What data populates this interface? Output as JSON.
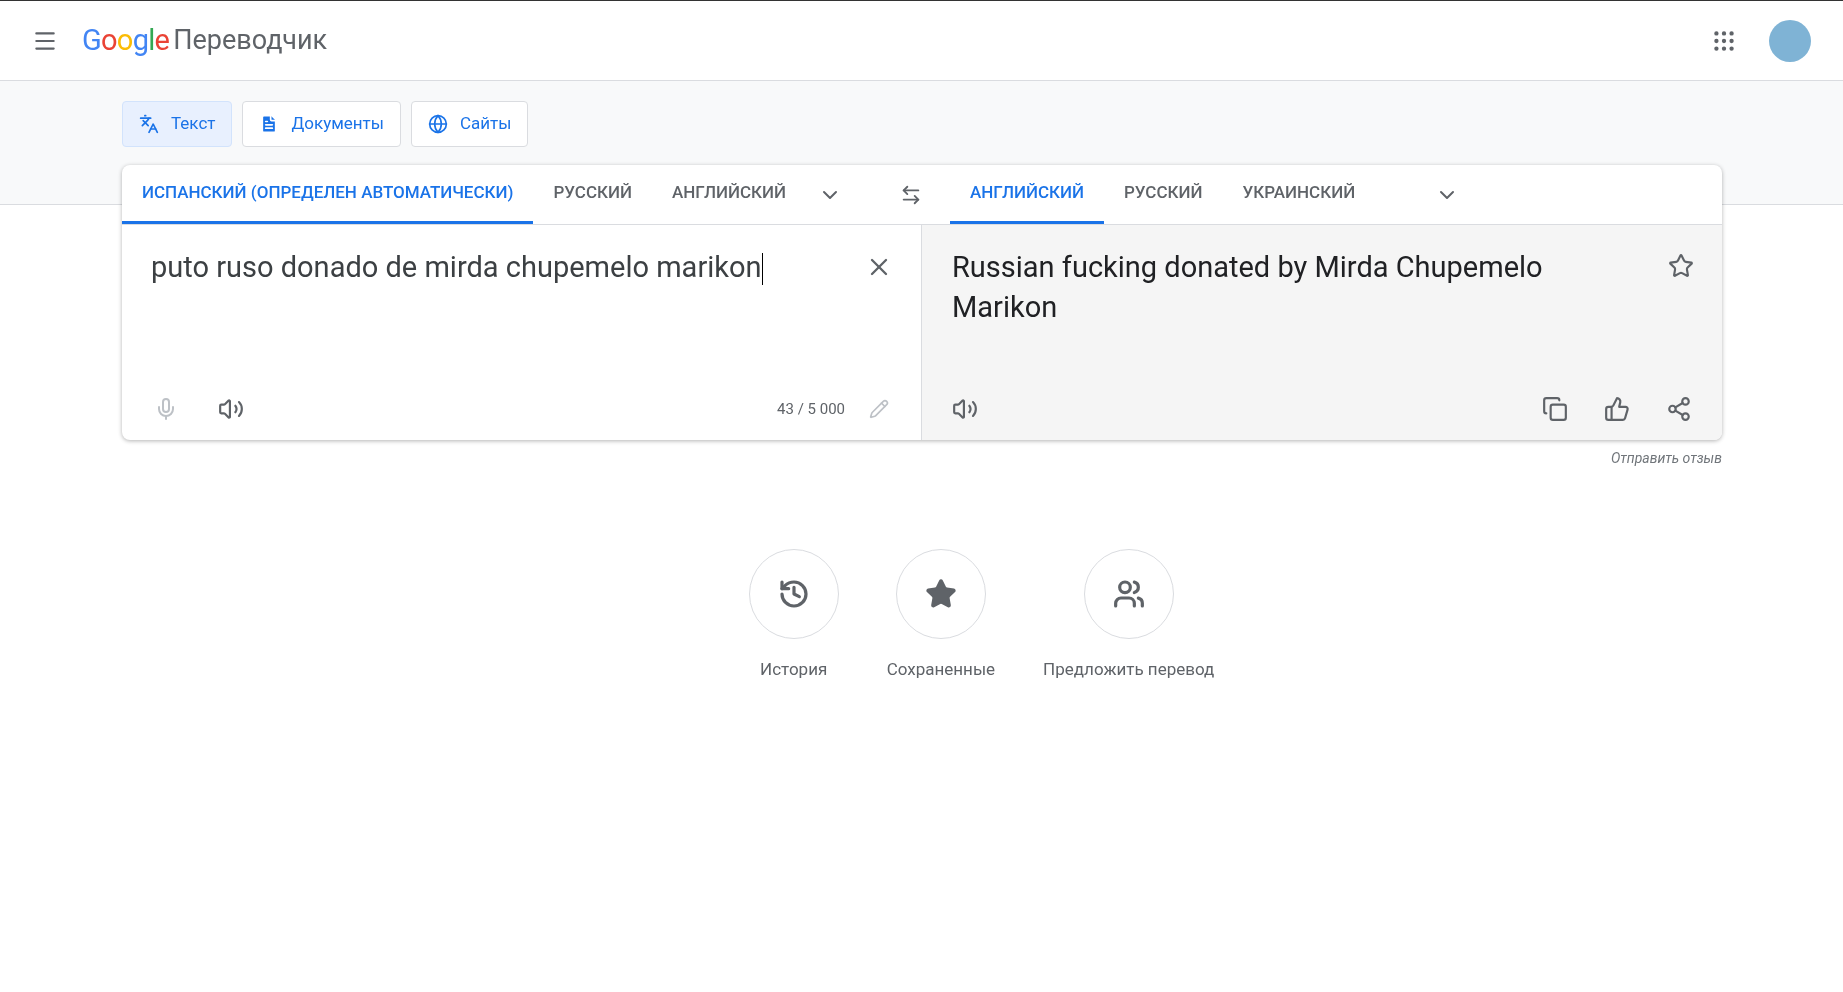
{
  "header": {
    "logo": "Google",
    "product": "Переводчик"
  },
  "mode_tabs": [
    {
      "label": "Текст",
      "kind": "text",
      "selected": true
    },
    {
      "label": "Документы",
      "kind": "documents",
      "selected": false
    },
    {
      "label": "Сайты",
      "kind": "sites",
      "selected": false
    }
  ],
  "source_languages": [
    {
      "label": "ИСПАНСКИЙ (ОПРЕДЕЛЕН АВТОМАТИЧЕСКИ)",
      "selected": true
    },
    {
      "label": "РУССКИЙ",
      "selected": false
    },
    {
      "label": "АНГЛИЙСКИЙ",
      "selected": false
    }
  ],
  "target_languages": [
    {
      "label": "АНГЛИЙСКИЙ",
      "selected": true
    },
    {
      "label": "РУССКИЙ",
      "selected": false
    },
    {
      "label": "УКРАИНСКИЙ",
      "selected": false
    }
  ],
  "source": {
    "value": "puto ruso donado de mirda chupemelo marikon",
    "char_count": "43 / 5 000"
  },
  "translation": {
    "text": "Russian fucking donated by Mirda Chupemelo Marikon",
    "saved": false
  },
  "feedback_link": "Отправить отзыв",
  "shortcuts": [
    {
      "label": "История",
      "kind": "history"
    },
    {
      "label": "Сохраненные",
      "kind": "saved"
    },
    {
      "label": "Предложить перевод",
      "kind": "community"
    }
  ]
}
